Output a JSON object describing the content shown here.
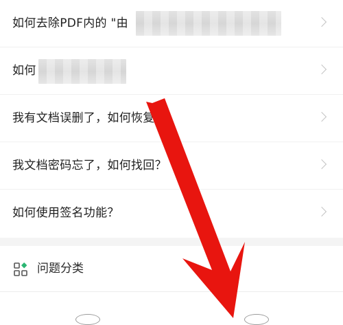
{
  "faq": {
    "items": [
      {
        "label": "如何去除PDF内的 \"由"
      },
      {
        "label": "如何"
      },
      {
        "label": "我有文档误删了，如何恢复？"
      },
      {
        "label": "我文档密码忘了，如何找回？"
      },
      {
        "label": "如何使用签名功能？"
      }
    ]
  },
  "category": {
    "label": "问题分类",
    "icon": "grid-category-icon"
  },
  "colors": {
    "arrow": "#e8150f",
    "accent": "#2bb673",
    "background": "#ffffff"
  }
}
